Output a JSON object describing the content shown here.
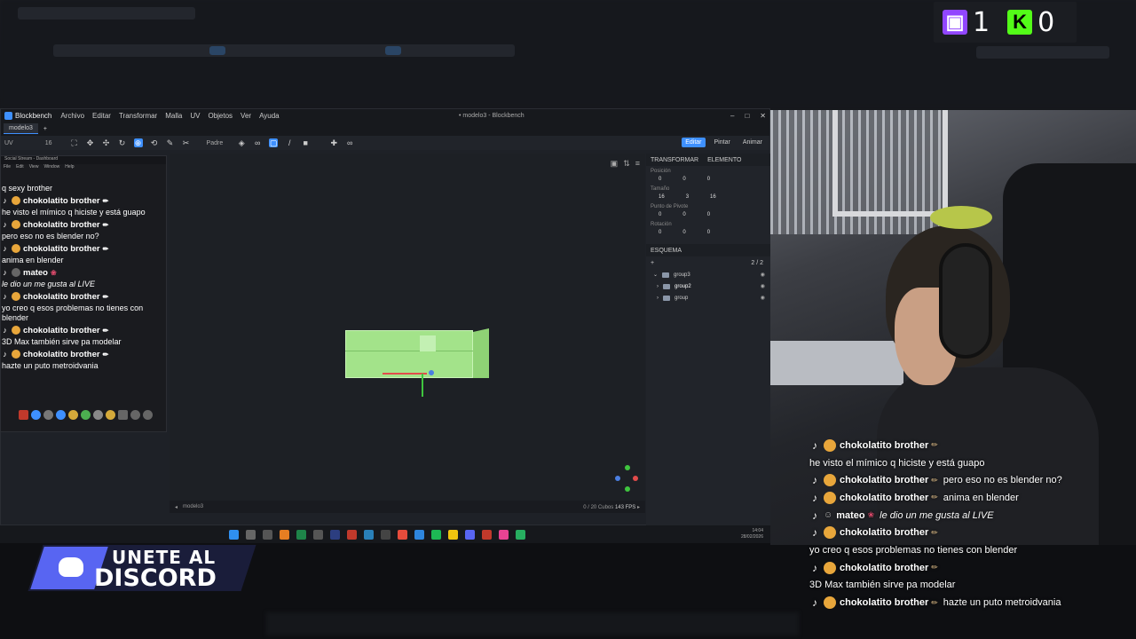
{
  "score": {
    "twitch_count": "1",
    "kick_count": "0"
  },
  "blockbench": {
    "app_name": "Blockbench",
    "menu": [
      "Archivo",
      "Editar",
      "Transformar",
      "Malla",
      "UV",
      "Objetos",
      "Ver",
      "Ayuda"
    ],
    "window_title": "• modelo3 - Blockbench",
    "tab_label": "modelo3",
    "toolbar": {
      "uv_label": "UV",
      "size_value": "16",
      "pivot_label": "Padre"
    },
    "modes": [
      "Editar",
      "Pintar",
      "Animar"
    ],
    "panel_tabs": [
      "TRANSFORMAR",
      "ELEMENTO"
    ],
    "properties": {
      "position_label": "Posición",
      "position": [
        "0",
        "0",
        "0"
      ],
      "size_label": "Tamaño",
      "size": [
        "16",
        "3",
        "16"
      ],
      "pivot_label": "Punto de Pivote",
      "pivot": [
        "0",
        "0",
        "0"
      ],
      "rotation_label": "Rotación",
      "rotation": [
        "0",
        "0",
        "0"
      ]
    },
    "outliner": {
      "title": "ESQUEMA",
      "count": "2 / 2",
      "items": [
        "group3",
        "group2",
        "group"
      ]
    },
    "status": {
      "file": "modelo3",
      "cubes": "0 / 20 Cubos",
      "fps": "143 FPS"
    }
  },
  "dashboard": {
    "title": "Social Stream - Dashboard",
    "menu": [
      "File",
      "Edit",
      "View",
      "Window",
      "Help"
    ],
    "messages": [
      {
        "type": "text",
        "text": "q sexy brother"
      },
      {
        "type": "name",
        "name": "chokolatito brother"
      },
      {
        "type": "text",
        "text": "he visto el mímico q hiciste y está guapo"
      },
      {
        "type": "name",
        "name": "chokolatito brother"
      },
      {
        "type": "text",
        "text": "pero eso no es blender no?"
      },
      {
        "type": "name",
        "name": "chokolatito brother"
      },
      {
        "type": "text",
        "text": "anima en blender"
      },
      {
        "type": "name",
        "name": "mateo"
      },
      {
        "type": "italic",
        "text": "le dio un me gusta al LIVE"
      },
      {
        "type": "name",
        "name": "chokolatito brother"
      },
      {
        "type": "text",
        "text": "yo creo q esos problemas no tienes con blender"
      },
      {
        "type": "name",
        "name": "chokolatito brother"
      },
      {
        "type": "text",
        "text": "3D Max también sirve pa modelar"
      },
      {
        "type": "name",
        "name": "chokolatito brother"
      },
      {
        "type": "text",
        "text": "hazte un puto metroidvania"
      }
    ]
  },
  "taskbar": {
    "time": "14:04",
    "date": "28/02/2026"
  },
  "discord": {
    "line1": "UNETE AL",
    "line2": "DISCORD"
  },
  "chat_overlay": [
    {
      "name": "chokolatito brother",
      "msg": ""
    },
    {
      "name": "",
      "msg": "he visto el mímico q hiciste y está guapo"
    },
    {
      "name": "chokolatito brother",
      "msg": "pero eso no es blender no?"
    },
    {
      "name": "chokolatito brother",
      "msg": "anima en blender"
    },
    {
      "name": "mateo",
      "msg": "le dio un me gusta al LIVE"
    },
    {
      "name": "chokolatito brother",
      "msg": ""
    },
    {
      "name": "",
      "msg": "yo creo q esos problemas no tienes con blender"
    },
    {
      "name": "chokolatito brother",
      "msg": ""
    },
    {
      "name": "",
      "msg": "3D Max también sirve pa modelar"
    },
    {
      "name": "chokolatito brother",
      "msg": "hazte un puto metroidvania"
    }
  ],
  "colors": {
    "accent": "#3e90ff",
    "twitch": "#9146ff",
    "kick": "#53fc18",
    "discord": "#5865f2",
    "cube": "#a3e38a"
  }
}
